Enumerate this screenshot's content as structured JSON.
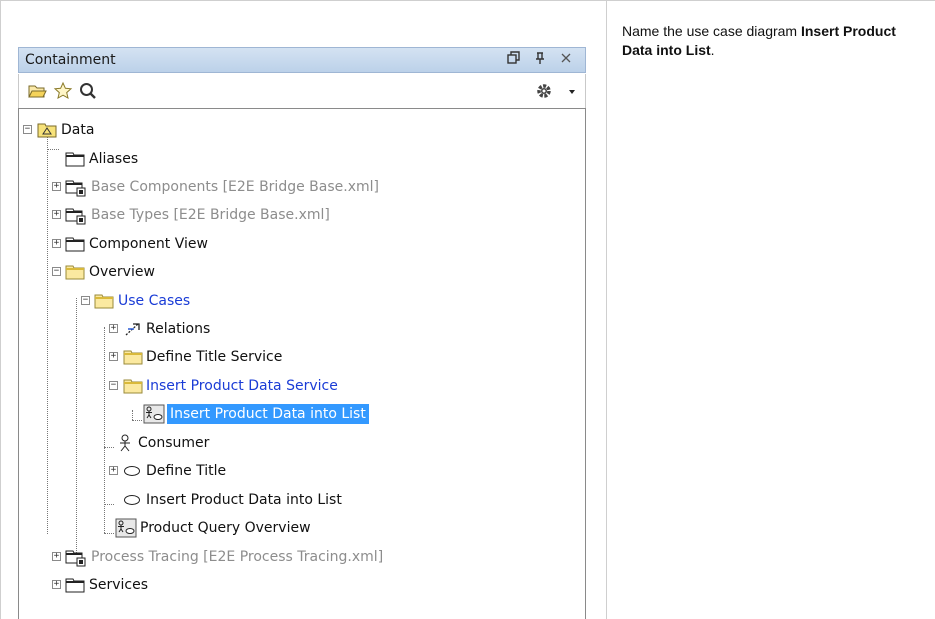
{
  "panel": {
    "title": "Containment",
    "buttons": [
      "restore-icon",
      "pin-icon",
      "close-icon"
    ]
  },
  "toolbar": {
    "icons": [
      "open-folder-icon",
      "star-icon",
      "search-icon",
      "gear-icon",
      "dropdown-arrow-icon"
    ]
  },
  "tree": {
    "root": "Data",
    "items": [
      {
        "label": "Aliases"
      },
      {
        "label": "Base Components [E2E Bridge Base.xml]"
      },
      {
        "label": "Base Types [E2E Bridge Base.xml]"
      },
      {
        "label": "Component View"
      },
      {
        "label": "Overview"
      },
      {
        "label": "Use Cases"
      },
      {
        "label": "Relations"
      },
      {
        "label": "Define Title Service"
      },
      {
        "label": "Insert Product Data Service"
      },
      {
        "label": "Insert Product Data into List"
      },
      {
        "label": "Consumer"
      },
      {
        "label": "Define Title"
      },
      {
        "label": "Insert Product Data into List"
      },
      {
        "label": "Product Query Overview"
      },
      {
        "label": "Process Tracing [E2E Process Tracing.xml]"
      },
      {
        "label": "Services"
      }
    ]
  },
  "instruction": {
    "prefix": "Name the use case diagram ",
    "bold": "Insert Product Data into List",
    "suffix": "."
  },
  "colors": {
    "selection": "#3399ff",
    "link_blue": "#1a3cd6",
    "referenced_grey": "#8d8d8d",
    "titlebar": "#c8d9ee"
  }
}
